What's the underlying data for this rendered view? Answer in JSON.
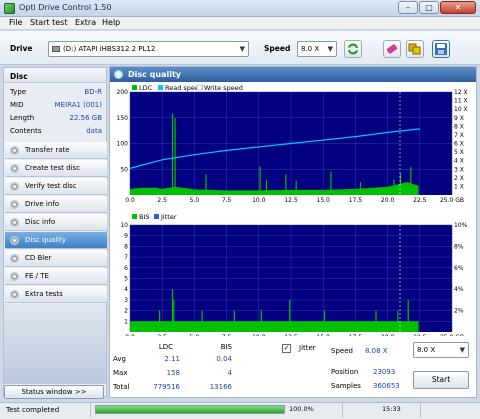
{
  "window": {
    "title": "Opti Drive Control 1.50"
  },
  "menu": [
    "File",
    "Start test",
    "Extra",
    "Help"
  ],
  "toolbar": {
    "drive_label": "Drive",
    "drive_value": "(D:)   ATAPI iHBS312   2 PL12",
    "speed_label": "Speed",
    "speed_value": "8.0 X"
  },
  "disc": {
    "header": "Disc",
    "rows": [
      {
        "label": "Type",
        "value": "BD-R"
      },
      {
        "label": "MID",
        "value": "MEIRA1 (001)"
      },
      {
        "label": "Length",
        "value": "22.56 GB"
      },
      {
        "label": "Contents",
        "value": "data"
      }
    ]
  },
  "nav": [
    "Transfer rate",
    "Create test disc",
    "Verify test disc",
    "Drive info",
    "Disc info",
    "Disc quality",
    "CD Bler",
    "FE / TE",
    "Extra tests"
  ],
  "nav_active": "Disc quality",
  "status_window_btn": "Status window >>",
  "panel": {
    "title": "Disc quality"
  },
  "chart_data": [
    {
      "type": "bar",
      "legend": [
        "LDC",
        "Read speed",
        "Write speed"
      ],
      "colors": {
        "ldc": "#00c000",
        "read": "#00c8ff",
        "write": "#ffffff",
        "background": "#000080",
        "grid": "#3a3ab0"
      },
      "x_ticks": [
        "0.0",
        "2.5",
        "5.0",
        "7.5",
        "10.0",
        "12.5",
        "15.0",
        "17.5",
        "20.0",
        "22.5",
        "25.0 GB"
      ],
      "y_ticks": [
        "200",
        "150",
        "100",
        "50"
      ],
      "y2_ticks": [
        "12 X",
        "11 X",
        "10 X",
        "9 X",
        "8 X",
        "7 X",
        "6 X",
        "5 X",
        "4 X",
        "3 X",
        "2 X",
        "1 X"
      ],
      "xlim": [
        0,
        25
      ],
      "ylim": [
        0,
        200
      ],
      "y2lim": [
        0,
        12
      ],
      "ldc_baseline": [
        [
          0,
          12
        ],
        [
          1,
          14
        ],
        [
          2,
          14
        ],
        [
          2.5,
          12
        ],
        [
          3.5,
          16
        ],
        [
          5,
          11
        ],
        [
          7.5,
          9
        ],
        [
          10,
          9
        ],
        [
          12.5,
          10
        ],
        [
          15,
          10
        ],
        [
          17.5,
          12
        ],
        [
          20,
          16
        ],
        [
          21.5,
          25
        ],
        [
          22.4,
          18
        ]
      ],
      "ldc_spikes": [
        [
          3.3,
          158
        ],
        [
          3.5,
          150
        ],
        [
          5.9,
          40
        ],
        [
          10.1,
          55
        ],
        [
          10.6,
          30
        ],
        [
          12.1,
          40
        ],
        [
          12.9,
          28
        ],
        [
          15.6,
          45
        ],
        [
          17.9,
          25
        ],
        [
          20.5,
          30
        ],
        [
          21,
          42
        ],
        [
          21.8,
          55
        ]
      ],
      "read_speed": [
        [
          0,
          3.1
        ],
        [
          2.5,
          4.1
        ],
        [
          5,
          4.7
        ],
        [
          7.5,
          5.2
        ],
        [
          10,
          5.6
        ],
        [
          12.5,
          6.0
        ],
        [
          15,
          6.4
        ],
        [
          17.5,
          6.8
        ],
        [
          20,
          7.3
        ],
        [
          22.5,
          7.7
        ]
      ]
    },
    {
      "type": "bar",
      "legend": [
        "BIS",
        "Jitter"
      ],
      "colors": {
        "bis": "#00c000",
        "background": "#000080",
        "grid": "#3a3ab0"
      },
      "x_ticks": [
        "0.0",
        "2.5",
        "5.0",
        "7.5",
        "10.0",
        "12.5",
        "15.0",
        "17.5",
        "20.0",
        "22.5",
        "25.0 GB"
      ],
      "y_ticks": [
        "10",
        "9",
        "8",
        "7",
        "6",
        "5",
        "4",
        "3",
        "2",
        "1"
      ],
      "y2_ticks": [
        "10%",
        "8%",
        "6%",
        "4%",
        "2%"
      ],
      "xlim": [
        0,
        25
      ],
      "ylim": [
        0,
        10
      ],
      "y2lim": [
        0,
        10
      ],
      "bis_spikes": [
        [
          2.3,
          2
        ],
        [
          3.3,
          4
        ],
        [
          3.4,
          3
        ],
        [
          5.6,
          2
        ],
        [
          8.1,
          2
        ],
        [
          10.2,
          2
        ],
        [
          12.4,
          3
        ],
        [
          15.1,
          2
        ],
        [
          19.1,
          2
        ],
        [
          20.8,
          2
        ],
        [
          21.6,
          3
        ]
      ]
    }
  ],
  "stats": {
    "col_ldc": "LDC",
    "col_bis": "BIS",
    "rows": [
      {
        "label": "Avg",
        "ldc": "2.11",
        "bis": "0.04"
      },
      {
        "label": "Max",
        "ldc": "158",
        "bis": "4"
      },
      {
        "label": "Total",
        "ldc": "779516",
        "bis": "13166"
      }
    ],
    "jitter_label": "Jitter",
    "jitter_checked": true,
    "speed_label": "Speed",
    "speed_value": "8.08 X",
    "speed_select": "8.0 X",
    "position_label": "Position",
    "position_value": "23093",
    "samples_label": "Samples",
    "samples_value": "360653",
    "start_btn": "Start"
  },
  "statusbar": {
    "text": "Test completed",
    "progress": 1.0,
    "progress_text": "100.0%",
    "time": "15:33"
  }
}
